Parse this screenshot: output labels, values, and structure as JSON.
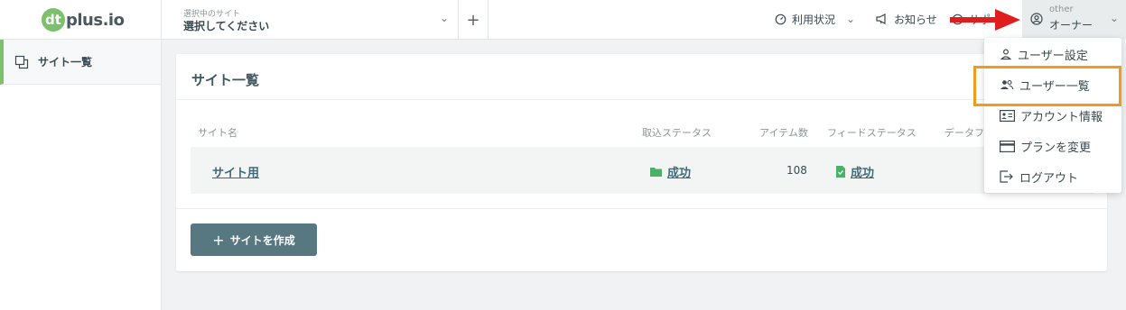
{
  "header": {
    "logo_badge": "dt",
    "logo_text": "plus.io",
    "site_select": {
      "small_label": "選択中のサイト",
      "value": "選択してください"
    },
    "add_site": "+",
    "nav": {
      "usage": "利用状況",
      "news": "お知らせ",
      "support": "サポート"
    },
    "user": {
      "name": "other",
      "role": "オーナー"
    }
  },
  "sidebar": {
    "items": [
      {
        "label": "サイト一覧"
      }
    ]
  },
  "main": {
    "title": "サイト一覧",
    "columns": {
      "site_name": "サイト名",
      "import_status": "取込ステータス",
      "item_count": "アイテム数",
      "feed_status": "フィードステータス",
      "data_status": "データフ"
    },
    "rows": [
      {
        "site_name": "サイト用",
        "import_status": "成功",
        "item_count": "108",
        "feed_status": "成功"
      }
    ],
    "create_button": "サイトを作成"
  },
  "dropdown": {
    "items": [
      {
        "label": "ユーザー設定",
        "icon": "user-icon"
      },
      {
        "label": "ユーザー一覧",
        "icon": "users-icon"
      },
      {
        "label": "アカウント情報",
        "icon": "id-card-icon"
      },
      {
        "label": "プランを変更",
        "icon": "credit-card-icon"
      },
      {
        "label": "ログアウト",
        "icon": "logout-icon"
      }
    ]
  },
  "colors": {
    "accent_green": "#7cc06b",
    "primary_button": "#587881",
    "highlight": "#f19a1c",
    "arrow": "#e01e1e"
  }
}
